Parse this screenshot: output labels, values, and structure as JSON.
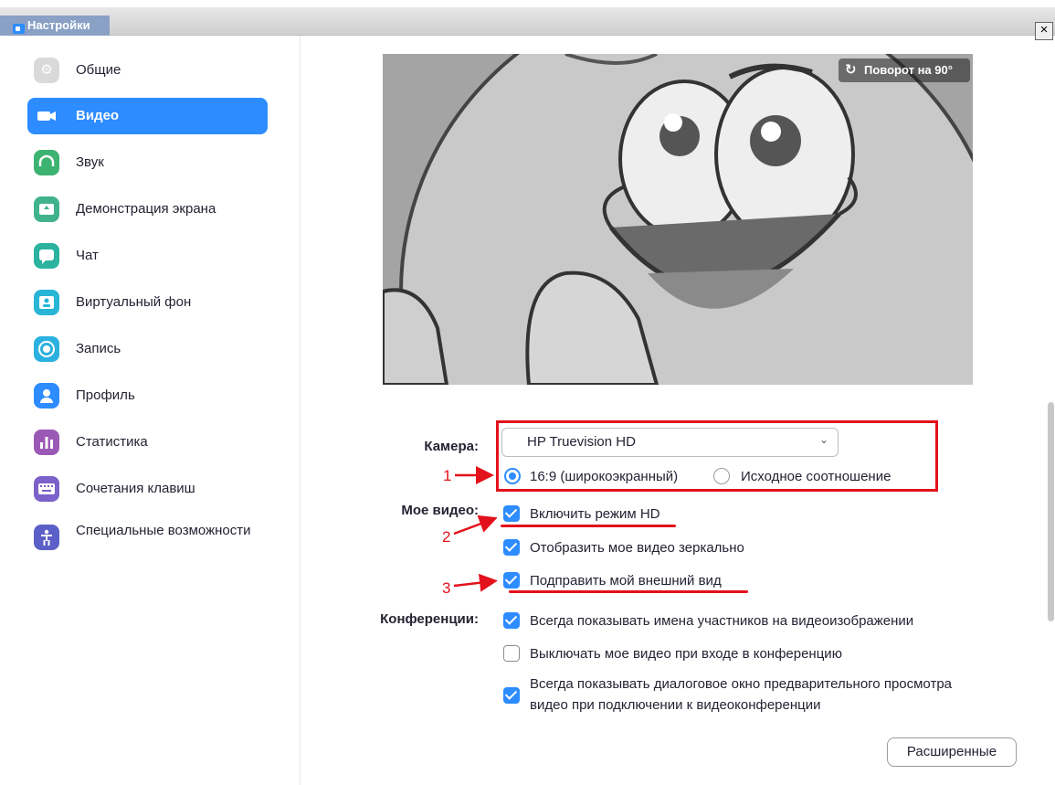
{
  "window": {
    "title": "Настройки",
    "close": "×"
  },
  "sidebar": {
    "items": [
      {
        "label": "Общие",
        "icon": "gear-icon",
        "color": "#d9d9d9"
      },
      {
        "label": "Видео",
        "icon": "video-camera-icon",
        "color": "#2d8cff",
        "active": true
      },
      {
        "label": "Звук",
        "icon": "headphones-icon",
        "color": "#3cb371"
      },
      {
        "label": "Демонстрация экрана",
        "icon": "share-screen-icon",
        "color": "#41b38a"
      },
      {
        "label": "Чат",
        "icon": "chat-bubble-icon",
        "color": "#2bb3a0"
      },
      {
        "label": "Виртуальный фон",
        "icon": "virtual-background-icon",
        "color": "#28b5d6"
      },
      {
        "label": "Запись",
        "icon": "record-icon",
        "color": "#2bb0e0"
      },
      {
        "label": "Профиль",
        "icon": "profile-icon",
        "color": "#2d8cff"
      },
      {
        "label": "Статистика",
        "icon": "statistics-icon",
        "color": "#9b59b6"
      },
      {
        "label": "Сочетания клавиш",
        "icon": "keyboard-icon",
        "color": "#7b61c9"
      },
      {
        "label": "Специальные возможности",
        "icon": "accessibility-icon",
        "color": "#5b5fc7"
      }
    ]
  },
  "video": {
    "rotate_label": "Поворот на 90°",
    "camera_label": "Камера:",
    "camera_value": "HP Truevision HD",
    "ratio_options": [
      {
        "label": "16:9 (широкоэкранный)",
        "selected": true
      },
      {
        "label": "Исходное соотношение",
        "selected": false
      }
    ],
    "my_video_label": "Мое видео:",
    "my_video_options": [
      {
        "label": "Включить режим HD",
        "checked": true
      },
      {
        "label": "Отобразить мое видео зеркально",
        "checked": true
      },
      {
        "label": "Подправить мой внешний вид",
        "checked": true
      }
    ],
    "meetings_label": "Конференции:",
    "meetings_options": [
      {
        "label": "Всегда показывать имена участников на видеоизображении",
        "checked": true
      },
      {
        "label": "Выключать мое видео при входе в конференцию",
        "checked": false
      },
      {
        "label_line1": "Всегда показывать диалоговое окно предварительного просмотра",
        "label_line2": "видео при подключении к видеоконференции",
        "checked": true
      }
    ],
    "advanced_button": "Расширенные"
  },
  "annotations": {
    "a1": "1",
    "a2": "2",
    "a3": "3",
    "color": "#e3111b"
  },
  "accent_color": "#2d8cff"
}
